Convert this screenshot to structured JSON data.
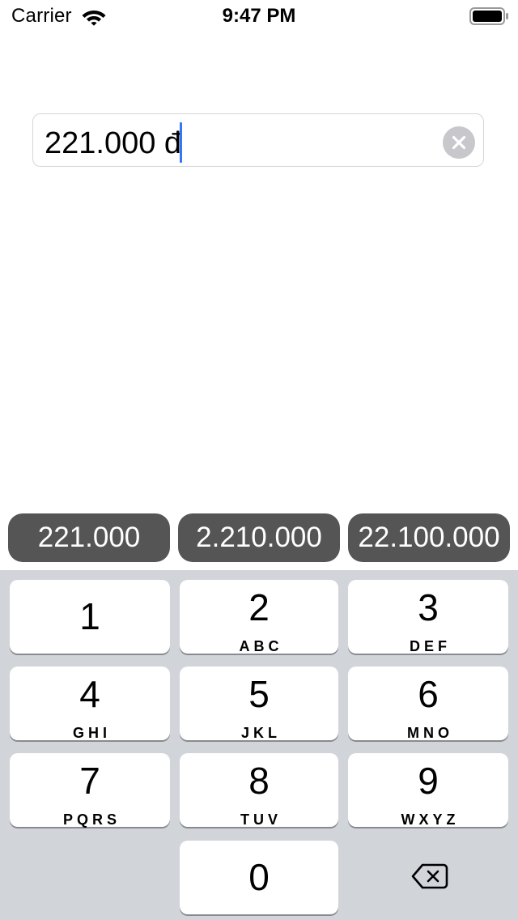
{
  "status_bar": {
    "carrier": "Carrier",
    "time": "9:47 PM",
    "icons": [
      "wifi-icon",
      "battery-icon"
    ]
  },
  "amount_field": {
    "value": "221.000 đ",
    "clear_icon": "clear-icon",
    "caret_color": "#3478f6"
  },
  "suggestions": [
    "221.000",
    "2.210.000",
    "22.100.000"
  ],
  "keypad": {
    "keys": [
      {
        "number": "1",
        "letters": ""
      },
      {
        "number": "2",
        "letters": "ABC"
      },
      {
        "number": "3",
        "letters": "DEF"
      },
      {
        "number": "4",
        "letters": "GHI"
      },
      {
        "number": "5",
        "letters": "JKL"
      },
      {
        "number": "6",
        "letters": "MNO"
      },
      {
        "number": "7",
        "letters": "PQRS"
      },
      {
        "number": "8",
        "letters": "TUV"
      },
      {
        "number": "9",
        "letters": "WXYZ"
      },
      {
        "number": "0",
        "letters": ""
      }
    ],
    "delete_icon": "backspace-icon"
  },
  "colors": {
    "keyboard_background": "#d1d4d9",
    "suggestion_background": "#555555",
    "key_background": "#ffffff"
  }
}
